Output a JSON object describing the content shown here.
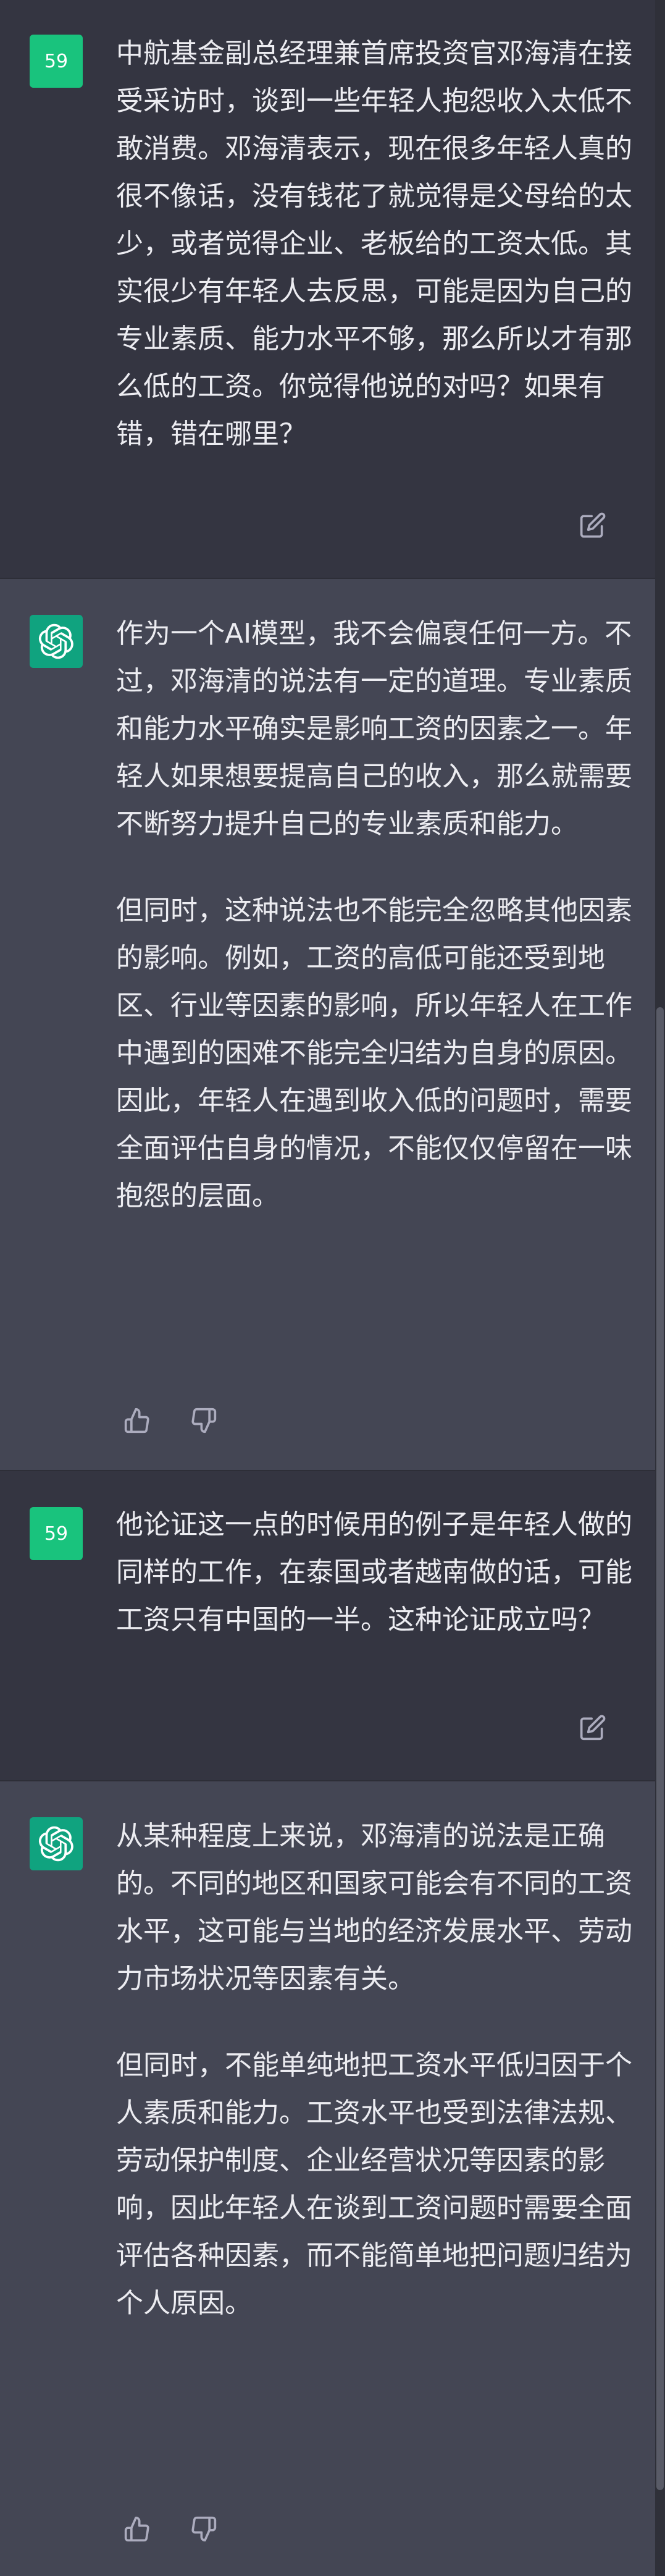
{
  "conversation": {
    "user_avatar_text": "59",
    "messages": [
      {
        "role": "user",
        "paragraphs": [
          "中航基金副总经理兼首席投资官邓海清在接受采访时，谈到一些年轻人抱怨收入太低不敢消费。邓海清表示，现在很多年轻人真的很不像话，没有钱花了就觉得是父母给的太少，或者觉得企业、老板给的工资太低。其实很少有年轻人去反思，可能是因为自己的专业素质、能力水平不够，那么所以才有那么低的工资。你觉得他说的对吗？如果有错，错在哪里？"
        ]
      },
      {
        "role": "assistant",
        "paragraphs": [
          "作为一个AI模型，我不会偏裒任何一方。不过，邓海清的说法有一定的道理。专业素质和能力水平确实是影响工资的因素之一。年轻人如果想要提高自己的收入，那么就需要不断努力提升自己的专业素质和能力。",
          "但同时，这种说法也不能完全忽略其他因素的影响。例如，工资的高低可能还受到地区、行业等因素的影响，所以年轻人在工作中遇到的困难不能完全归结为自身的原因。因此，年轻人在遇到收入低的问题时，需要全面评估自身的情况，不能仅仅停留在一味抱怨的层面。"
        ]
      },
      {
        "role": "user",
        "paragraphs": [
          "他论证这一点的时候用的例子是年轻人做的同样的工作，在泰国或者越南做的话，可能工资只有中国的一半。这种论证成立吗？"
        ]
      },
      {
        "role": "assistant",
        "paragraphs": [
          "从某种程度上来说，邓海清的说法是正确的。不同的地区和国家可能会有不同的工资水平，这可能与当地的经济发展水平、劳动力市场状况等因素有关。",
          "但同时，不能单纯地把工资水平低归因于个人素质和能力。工资水平也受到法律法规、劳动保护制度、企业经营状况等因素的影响，因此年轻人在谈到工资问题时需要全面评估各种因素，而不能简单地把问题归结为个人原因。"
        ]
      }
    ]
  },
  "icons": {
    "edit": "edit-icon",
    "thumbs_up": "thumbs-up-icon",
    "thumbs_down": "thumbs-down-icon",
    "assistant_logo": "openai-logo-icon"
  },
  "colors": {
    "user_bg": "#343541",
    "assistant_bg": "#444654",
    "user_avatar": "#19c37d",
    "assistant_avatar": "#10a37f",
    "text": "#ececf1",
    "icon": "#acacbe"
  }
}
